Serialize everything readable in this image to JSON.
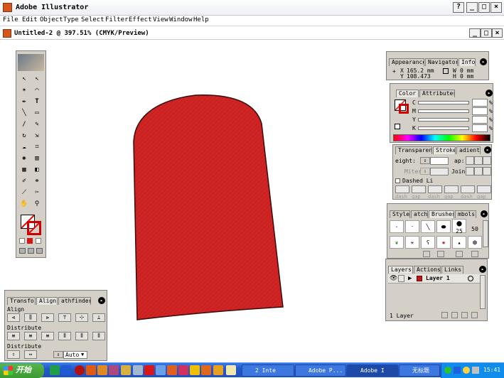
{
  "app": {
    "title": "Adobe Illustrator"
  },
  "menu": [
    "File",
    "Edit",
    "Object",
    "Type",
    "Select",
    "Filter",
    "Effect",
    "View",
    "Window",
    "Help"
  ],
  "document": {
    "title": "Untitled-2 @ 397.51% (CMYK/Preview)"
  },
  "shape": {
    "fill": "#cc1f1f",
    "stroke": "#3a0a0a"
  },
  "info_panel": {
    "tabs": [
      "Appearance",
      "Navigator",
      "Info"
    ],
    "x_label": "X",
    "x_value": "165.2 mm",
    "y_label": "Y",
    "y_value": "108.473",
    "w_label": "W",
    "w_value": "0 mm",
    "h_label": "H",
    "h_value": "0 mm"
  },
  "color_panel": {
    "tabs": [
      "Color",
      "Attributes"
    ],
    "channels": [
      "C",
      "M",
      "Y",
      "K"
    ],
    "unit": "%"
  },
  "stroke_panel": {
    "tabs": [
      "Transparenc",
      "Stroke",
      "adient"
    ],
    "weight_label": "eight:",
    "cap_label": "ap:",
    "miter_label": "Miter",
    "join_label": "Join:",
    "dashed_label": "Dashed Li",
    "dash_labels": [
      "dash",
      "gap",
      "dash",
      "gap",
      "dash",
      "gap"
    ]
  },
  "brushes_panel": {
    "tabs": [
      "Styles",
      "atche",
      "Brushes",
      "mbols"
    ],
    "brush_sizes": [
      "25",
      "50"
    ]
  },
  "layers_panel": {
    "tabs": [
      "Layers",
      "Actions",
      "Links"
    ],
    "layer_name": "Layer 1",
    "footer": "1 Layer"
  },
  "align_panel": {
    "tabs": [
      "Transform",
      "Align",
      "athfinder"
    ],
    "align_label": "Align",
    "distribute_label": "Distribute",
    "distribute_spacing_label": "Distribute",
    "spacing_value": "Auto"
  },
  "taskbar": {
    "start_label": "开始",
    "buttons": [
      "2 Inte",
      "Adobe P...",
      "Adobe I",
      "无标题"
    ],
    "time": "15:41"
  }
}
